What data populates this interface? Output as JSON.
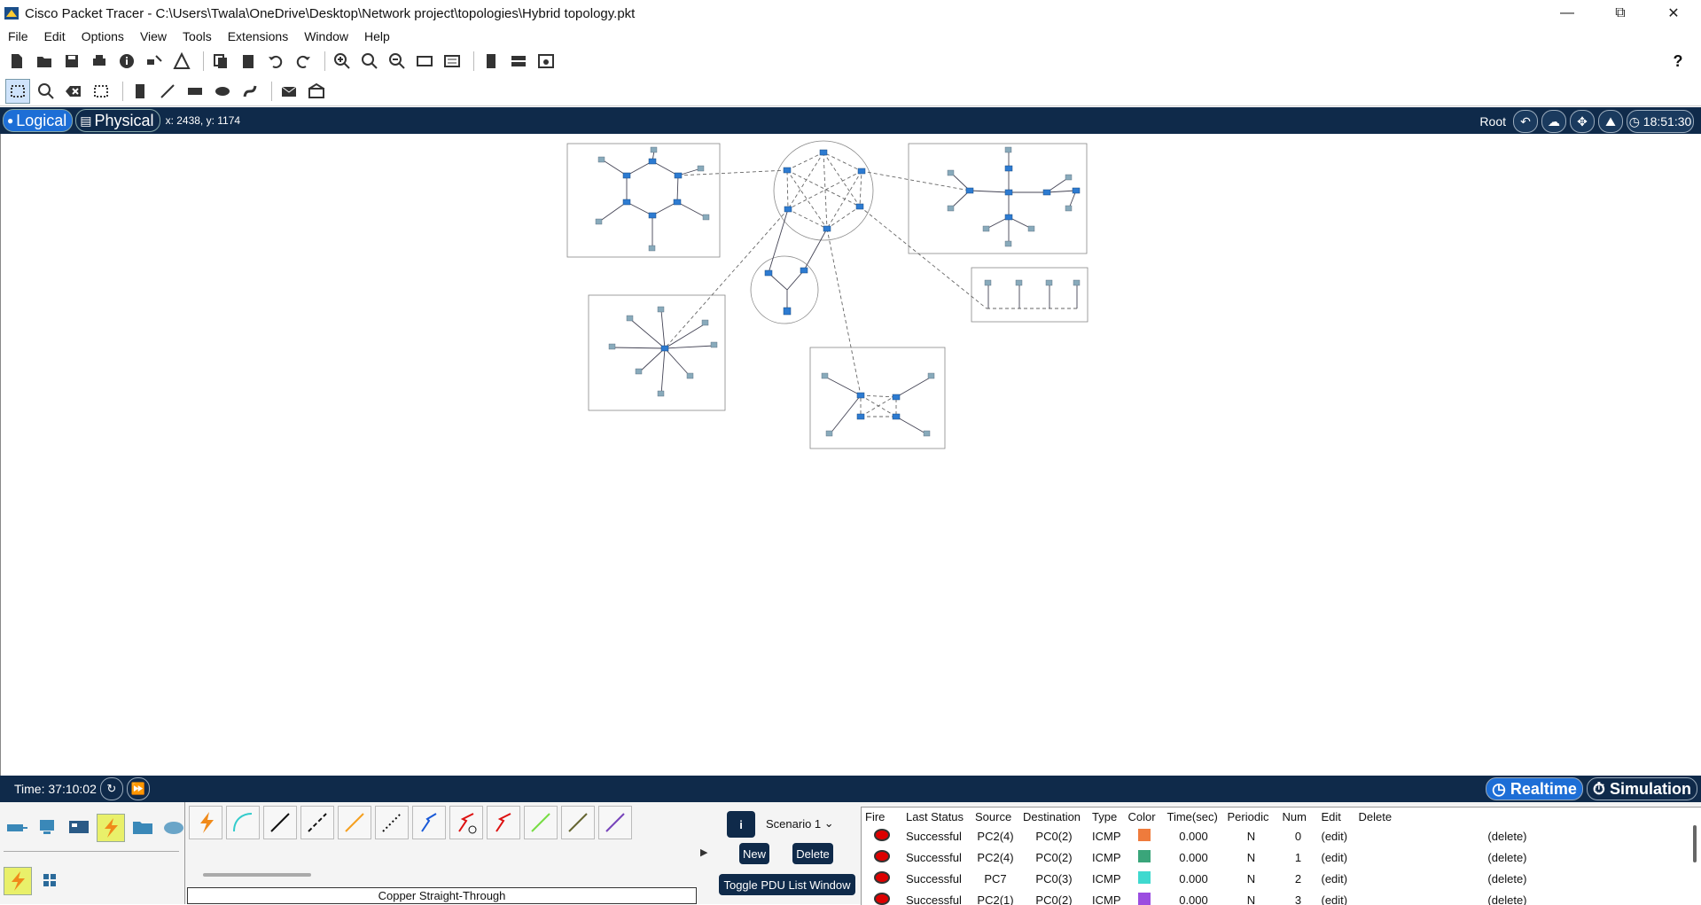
{
  "window": {
    "title": "Cisco Packet Tracer - C:\\Users\\Twala\\OneDrive\\Desktop\\Network project\\topologies\\Hybrid topology.pkt"
  },
  "menu": [
    "File",
    "Edit",
    "Options",
    "View",
    "Tools",
    "Extensions",
    "Window",
    "Help"
  ],
  "mode": {
    "logical": "Logical",
    "physical": "Physical",
    "coords": "x: 2438, y: 1174",
    "root": "Root",
    "clock": "18:51:30"
  },
  "timebar": {
    "time": "Time: 37:10:02",
    "realtime": "Realtime",
    "simulation": "Simulation"
  },
  "connections": {
    "selected_label": "Copper Straight-Through"
  },
  "scenario": {
    "info": "i",
    "name": "Scenario 1",
    "new": "New",
    "delete": "Delete",
    "toggle": "Toggle PDU List Window"
  },
  "pdu_table": {
    "headers": [
      "Fire",
      "Last Status",
      "Source",
      "Destination",
      "Type",
      "Color",
      "Time(sec)",
      "Periodic",
      "Num",
      "Edit",
      "Delete"
    ],
    "rows": [
      {
        "status": "Successful",
        "source": "PC2(4)",
        "dest": "PC0(2)",
        "type": "ICMP",
        "color": "#ef7b3c",
        "time": "0.000",
        "periodic": "N",
        "num": "0",
        "edit": "(edit)",
        "del": "(delete)"
      },
      {
        "status": "Successful",
        "source": "PC2(4)",
        "dest": "PC0(2)",
        "type": "ICMP",
        "color": "#3aa57a",
        "time": "0.000",
        "periodic": "N",
        "num": "1",
        "edit": "(edit)",
        "del": "(delete)"
      },
      {
        "status": "Successful",
        "source": "PC7",
        "dest": "PC0(3)",
        "type": "ICMP",
        "color": "#3fd9cf",
        "time": "0.000",
        "periodic": "N",
        "num": "2",
        "edit": "(edit)",
        "del": "(delete)"
      },
      {
        "status": "Successful",
        "source": "PC2(1)",
        "dest": "PC0(2)",
        "type": "ICMP",
        "color": "#9b4de0",
        "time": "0.000",
        "periodic": "N",
        "num": "3",
        "edit": "(edit)",
        "del": "(delete)"
      }
    ]
  }
}
